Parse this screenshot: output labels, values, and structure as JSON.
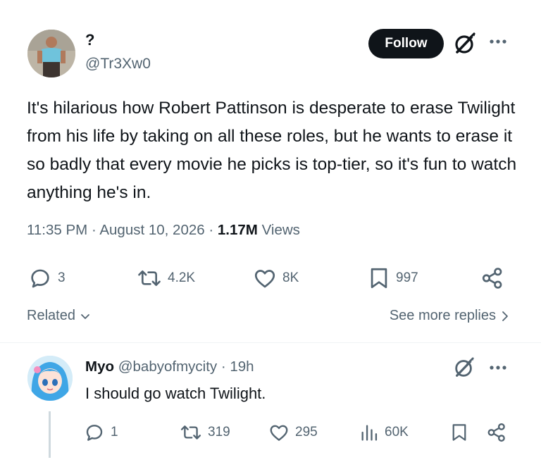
{
  "tweet": {
    "display_name": "?",
    "handle": "@Tr3Xw0",
    "follow_label": "Follow",
    "text": "It's hilarious how Robert Pattinson is desperate to erase Twilight from his life by taking on all these roles, but he wants to erase it so badly that every movie he picks is top-tier, so it's fun to watch anything he's in.",
    "time": "11:35 PM",
    "date": "August 10, 2026",
    "views_count": "1.17M",
    "views_label": "Views",
    "separator": "·",
    "actions": {
      "replies": "3",
      "reposts": "4.2K",
      "likes": "8K",
      "bookmarks": "997"
    }
  },
  "related_label": "Related",
  "see_more_label": "See more replies",
  "reply": {
    "display_name": "Myo",
    "handle": "@babyofmycity",
    "separator": "·",
    "time": "19h",
    "text": "I should go watch Twilight.",
    "actions": {
      "replies": "1",
      "reposts": "319",
      "likes": "295",
      "views": "60K"
    }
  },
  "colors": {
    "text": "#0f1419",
    "secondary": "#536471",
    "follow_bg": "#0f1419",
    "divider": "#eff3f4"
  },
  "icons": [
    "grok-icon",
    "more-icon",
    "reply-icon",
    "repost-icon",
    "like-icon",
    "bookmark-icon",
    "share-icon",
    "views-icon",
    "chevron-down-icon",
    "chevron-right-icon"
  ]
}
